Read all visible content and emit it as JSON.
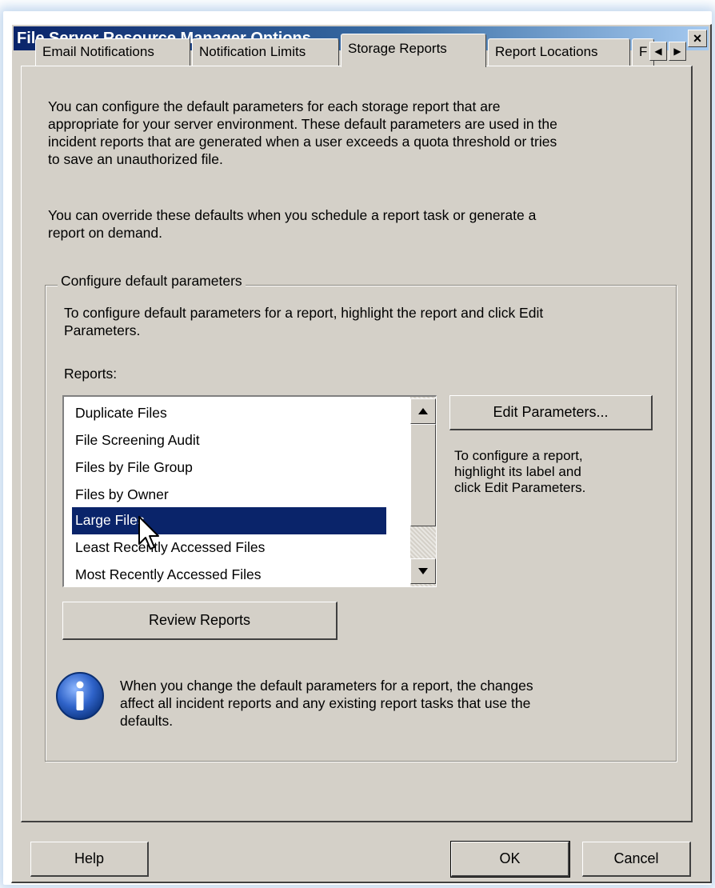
{
  "window": {
    "title": "File Server Resource Manager Options",
    "close_label": "×"
  },
  "tabs": [
    {
      "label": "Email Notifications",
      "active": false
    },
    {
      "label": "Notification Limits",
      "active": false
    },
    {
      "label": "Storage Reports",
      "active": true
    },
    {
      "label": "Report Locations",
      "active": false
    },
    {
      "label": "F",
      "active": false
    }
  ],
  "tab_scroll": {
    "left": "◀",
    "right": "▶"
  },
  "panel": {
    "intro_lines": [
      "You can configure the default parameters for each storage report that are",
      "appropriate for your server environment. These default parameters are used in the",
      "incident reports that are generated when a user exceeds a quota threshold or tries",
      "to save an unauthorized file."
    ],
    "override_lines": [
      "You can override these defaults when you schedule a report task or generate a",
      "report on demand."
    ]
  },
  "group": {
    "legend": "Configure default parameters",
    "instruction_lines": [
      "To configure default parameters for a report, highlight the report and click Edit",
      "Parameters."
    ],
    "reports_label": "Reports:",
    "reports": [
      "Duplicate Files",
      "File Screening Audit",
      "Files by File Group",
      "Files by Owner",
      "Large Files",
      "Least Recently Accessed Files",
      "Most Recently Accessed Files"
    ],
    "selected_report": "Large Files",
    "scroll_position": 0.35,
    "edit_button": "Edit Parameters...",
    "hint_lines": [
      "To configure a report,",
      "highlight its label and",
      "click Edit Parameters."
    ],
    "review_button": "Review Reports",
    "info_lines": [
      "When you change the default parameters for a report, the changes",
      "affect all incident reports and any existing report tasks that use the",
      "defaults."
    ]
  },
  "footer": {
    "help": "Help",
    "ok": "OK",
    "cancel": "Cancel"
  }
}
